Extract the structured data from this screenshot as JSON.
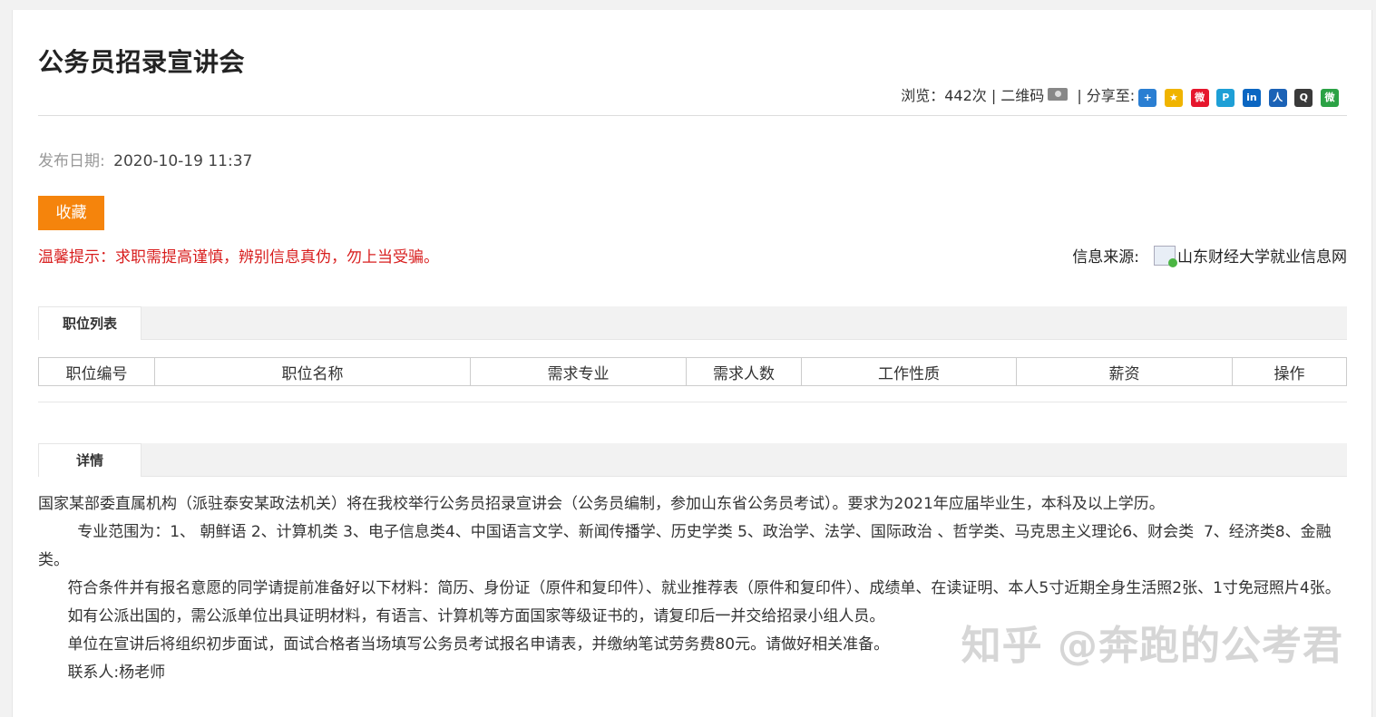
{
  "article": {
    "title": "公务员招录宣讲会",
    "views_label": "浏览：442次 | 二维码",
    "share_label": "| 分享至:",
    "pubdate_label": "发布日期:",
    "pubdate_value": "2020-10-19 11:37",
    "favorite_label": "收藏",
    "tip": "温馨提示：求职需提高谨慎，辨别信息真伪，勿上当受骗。",
    "source_label": "信息来源:",
    "source_value": "山东财经大学就业信息网"
  },
  "share_icons": [
    {
      "name": "add-share-icon",
      "glyph": "+",
      "color": "#2a7ed2"
    },
    {
      "name": "qzone-share-icon",
      "glyph": "★",
      "color": "#f0b400"
    },
    {
      "name": "weibo-share-icon",
      "glyph": "微",
      "color": "#e6162d"
    },
    {
      "name": "tencent-weibo-share-icon",
      "glyph": "P",
      "color": "#1e9fd6"
    },
    {
      "name": "linkedin-share-icon",
      "glyph": "in",
      "color": "#0a66c2"
    },
    {
      "name": "renren-share-icon",
      "glyph": "人",
      "color": "#1b62b6"
    },
    {
      "name": "qq-share-icon",
      "glyph": "Q",
      "color": "#3a3a3a"
    },
    {
      "name": "wechat-share-icon",
      "glyph": "微",
      "color": "#2ba245"
    }
  ],
  "positions": {
    "tab": "职位列表",
    "columns": [
      "职位编号",
      "职位名称",
      "需求专业",
      "需求人数",
      "工作性质",
      "薪资",
      "操作"
    ]
  },
  "detail": {
    "tab": "详情",
    "paragraphs": [
      "国家某部委直属机构（派驻泰安某政法机关）将在我校举行公务员招录宣讲会（公务员编制，参加山东省公务员考试）。要求为2021年应届毕业生，本科及以上学历。",
      "        专业范围为：1、 朝鲜语 2、计算机类 3、电子信息类4、中国语言文学、新闻传播学、历史学类 5、政治学、法学、国际政治 、哲学类、马克思主义理论6、财会类  7、经济类8、金融类。",
      "      符合条件并有报名意愿的同学请提前准备好以下材料：简历、身份证（原件和复印件）、就业推荐表（原件和复印件）、成绩单、在读证明、本人5寸近期全身生活照2张、1寸免冠照片4张。",
      "      如有公派出国的，需公派单位出具证明材料，有语言、计算机等方面国家等级证书的，请复印后一并交给招录小组人员。",
      "      单位在宣讲后将组织初步面试，面试合格者当场填写公务员考试报名申请表，并缴纳笔试劳务费80元。请做好相关准备。",
      "      联系人:杨老师"
    ]
  },
  "watermark": "知乎 @奔跑的公考君"
}
